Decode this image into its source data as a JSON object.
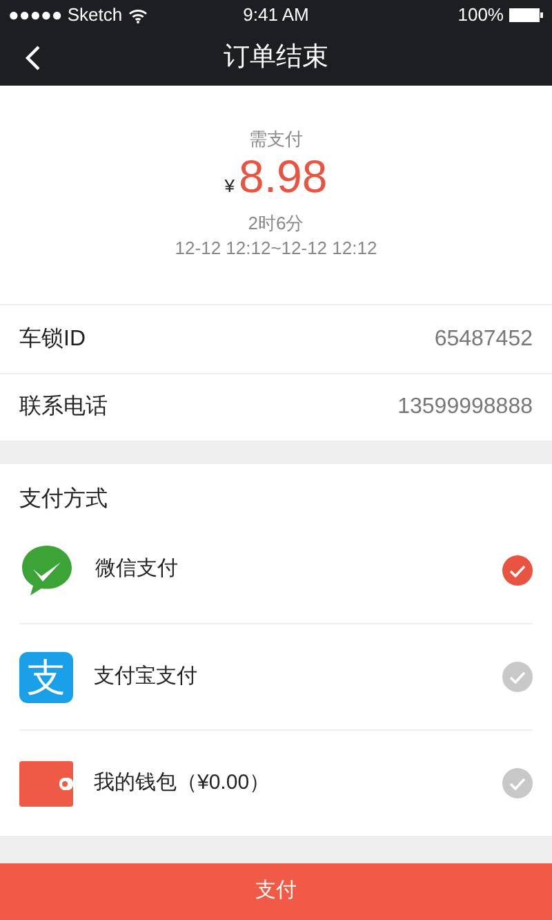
{
  "status_bar": {
    "carrier": "●●●●● Sketch",
    "time": "9:41 AM",
    "battery": "100%"
  },
  "nav": {
    "title": "订单结束"
  },
  "summary": {
    "label": "需支付",
    "currency": "¥",
    "amount": "8.98",
    "duration": "2时6分",
    "period": "12-12 12:12~12-12 12:12"
  },
  "info": [
    {
      "label": "车锁ID",
      "value": "65487452"
    },
    {
      "label": "联系电话",
      "value": "13599998888"
    }
  ],
  "payment": {
    "title": "支付方式",
    "methods": [
      {
        "kind": "wechat",
        "label": "微信支付",
        "selected": true
      },
      {
        "kind": "alipay",
        "glyph": "支",
        "label": "支付宝支付",
        "selected": false
      },
      {
        "kind": "wallet",
        "label": "我的钱包（¥0.00）",
        "selected": false
      }
    ]
  },
  "pay_button": "支付"
}
